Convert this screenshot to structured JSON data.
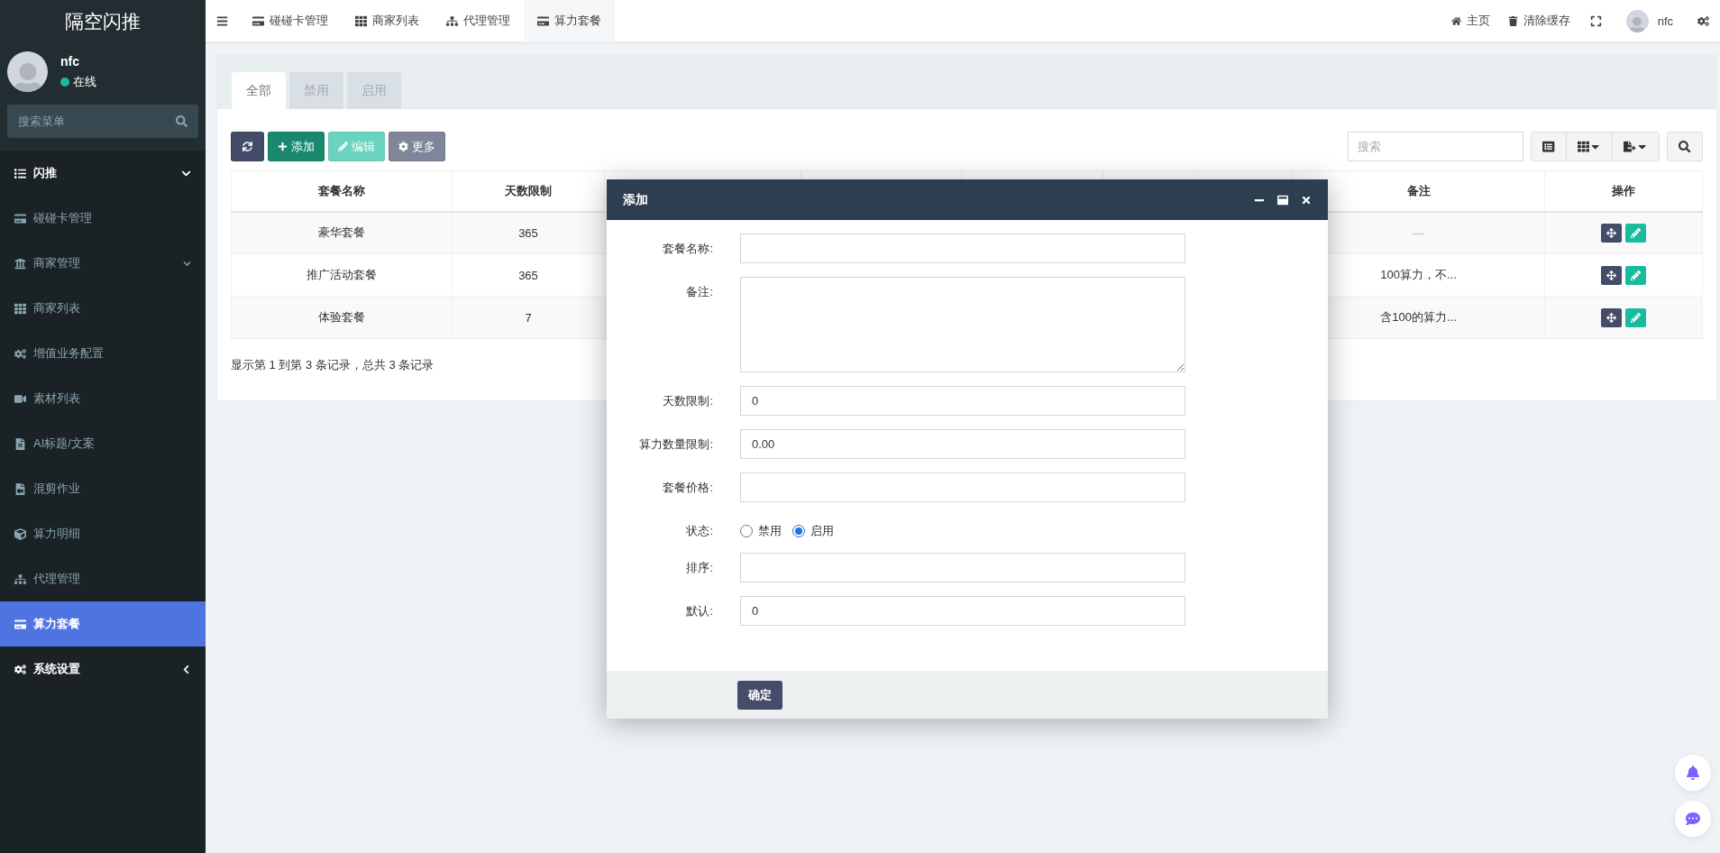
{
  "app": {
    "logo": "隔空闪推"
  },
  "user": {
    "name": "nfc",
    "status": "在线"
  },
  "sidebar": {
    "search": {
      "placeholder": "搜索菜单"
    },
    "items": [
      {
        "label": "闪推",
        "kind": "group",
        "expanded": true,
        "selected": false,
        "children": [
          {
            "label": "碰碰卡管理",
            "kind": "link",
            "selected": false
          },
          {
            "label": "商家管理",
            "kind": "folder",
            "expanded": true,
            "selected": false,
            "children": [
              {
                "label": "商家列表",
                "kind": "link",
                "selected": false
              },
              {
                "label": "增值业务配置",
                "kind": "link",
                "selected": false
              },
              {
                "label": "素材列表",
                "kind": "link",
                "selected": false
              },
              {
                "label": "AI标题/文案",
                "kind": "link",
                "selected": false
              },
              {
                "label": "混剪作业",
                "kind": "link",
                "selected": false
              },
              {
                "label": "算力明细",
                "kind": "link",
                "selected": false
              }
            ]
          },
          {
            "label": "代理管理",
            "kind": "link",
            "selected": false
          },
          {
            "label": "算力套餐",
            "kind": "link",
            "selected": true
          }
        ]
      },
      {
        "label": "系统设置",
        "kind": "group",
        "expanded": false,
        "selected": false
      }
    ]
  },
  "topbar": {
    "tabs": [
      {
        "label": "碰碰卡管理",
        "selected": false
      },
      {
        "label": "商家列表",
        "selected": false
      },
      {
        "label": "代理管理",
        "selected": false
      },
      {
        "label": "算力套餐",
        "selected": true
      }
    ],
    "links": [
      "主页",
      "清除缓存"
    ],
    "user": "nfc"
  },
  "filter_tabs": [
    {
      "label": "全部",
      "selected": true
    },
    {
      "label": "禁用",
      "selected": false
    },
    {
      "label": "启用",
      "selected": false
    }
  ],
  "toolbar": {
    "buttons": [
      {
        "kind": "refresh",
        "disabled": false
      },
      {
        "kind": "add",
        "label": "添加",
        "disabled": false
      },
      {
        "kind": "edit",
        "label": "编辑",
        "disabled": true
      },
      {
        "kind": "more",
        "label": "更多",
        "disabled": false
      }
    ],
    "search": {
      "placeholder": "搜索"
    }
  },
  "table": {
    "columns": [
      "套餐名称",
      "天数限制",
      "备注",
      "操作"
    ],
    "rows": [
      {
        "name": "豪华套餐",
        "days": "365",
        "note": "—",
        "note_empty": true
      },
      {
        "name": "推广活动套餐",
        "days": "365",
        "note": "100算力，不...",
        "note_empty": false
      },
      {
        "name": "体验套餐",
        "days": "7",
        "note": "含100的算力...",
        "note_empty": false
      }
    ],
    "footer": "显示第 1 到第 3 条记录，总共 3 条记录"
  },
  "dialog": {
    "title": "添加",
    "fields": [
      {
        "label": "套餐名称:",
        "kind": "text"
      },
      {
        "label": "备注:",
        "kind": "textarea"
      },
      {
        "label": "天数限制:",
        "kind": "text",
        "value": "0"
      },
      {
        "label": "算力数量限制:",
        "kind": "text",
        "value": "0.00"
      },
      {
        "label": "套餐价格:",
        "kind": "text"
      },
      {
        "label": "状态:",
        "kind": "radio",
        "options": [
          {
            "label": "禁用",
            "selected": false
          },
          {
            "label": "启用",
            "selected": true
          }
        ]
      },
      {
        "label": "排序:",
        "kind": "text"
      },
      {
        "label": "默认:",
        "kind": "text",
        "value": "0"
      }
    ],
    "submit": "确定"
  }
}
